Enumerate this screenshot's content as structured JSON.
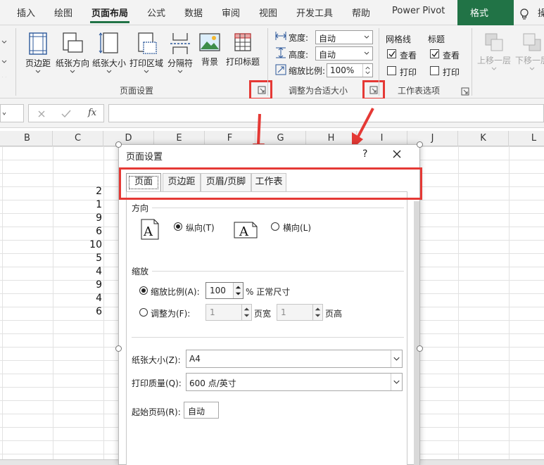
{
  "ribbon_tabs": {
    "insert": "插入",
    "draw": "绘图",
    "page_layout": "页面布局",
    "formulas": "公式",
    "data": "数据",
    "review": "审阅",
    "view": "视图",
    "developer": "开发工具",
    "help": "帮助",
    "power_pivot": "Power Pivot",
    "format": "格式",
    "tell_me": "操"
  },
  "page_setup_group": {
    "margins": "页边距",
    "orientation": "纸张方向",
    "size": "纸张大小",
    "print_area": "打印区域",
    "breaks": "分隔符",
    "background": "背景",
    "print_titles": "打印标题",
    "group_label": "页面设置"
  },
  "scale_group": {
    "width_label": "宽度:",
    "width_value": "自动",
    "height_label": "高度:",
    "height_value": "自动",
    "scale_label": "缩放比例:",
    "scale_value": "100%",
    "group_label": "调整为合适大小"
  },
  "sheet_options_group": {
    "gridlines": "网格线",
    "headings": "标题",
    "view": "查看",
    "print": "打印",
    "group_label": "工作表选项",
    "gridlines_view_checked": true,
    "gridlines_print_checked": false,
    "headings_view_checked": true,
    "headings_print_checked": false
  },
  "arrange_group": {
    "bring_forward": "上移一层",
    "send_backward": "下移一层"
  },
  "formula_bar": {
    "fx": "fx"
  },
  "columns": [
    "B",
    "C",
    "D",
    "E",
    "F",
    "G",
    "H",
    "I",
    "J",
    "K",
    "L"
  ],
  "column_c_values": [
    "2",
    "1",
    "9",
    "6",
    "10",
    "5",
    "4",
    "9",
    "4",
    "6"
  ],
  "dialog": {
    "title": "页面设置",
    "help": "?",
    "tabs": [
      "页面",
      "页边距",
      "页眉/页脚",
      "工作表"
    ],
    "orientation_section": "方向",
    "portrait": "纵向(T)",
    "landscape": "横向(L)",
    "portrait_selected": true,
    "scaling_section": "缩放",
    "adjust_to": "缩放比例(A):",
    "adjust_value": "100",
    "normal_size": "% 正常尺寸",
    "fit_to": "调整为(F):",
    "fit_pages_wide": "1",
    "pages_wide_label": "页宽",
    "fit_pages_tall": "1",
    "pages_tall_label": "页高",
    "paper_size_label": "纸张大小(Z):",
    "paper_size_value": "A4",
    "print_quality_label": "打印质量(Q):",
    "print_quality_value": "600 点/英寸",
    "first_page_label": "起始页码(R):",
    "first_page_value": "自动",
    "doc_icon_letter": "A"
  },
  "colors": {
    "accent": "#217346",
    "highlight": "#e53935"
  }
}
